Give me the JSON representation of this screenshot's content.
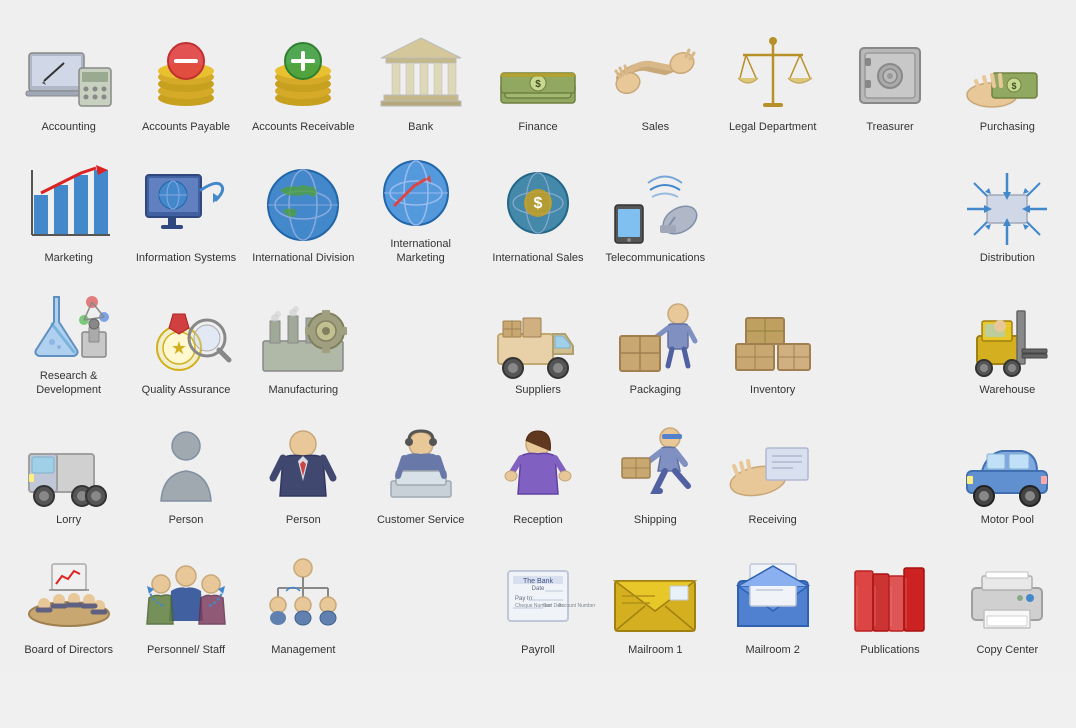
{
  "items": [
    {
      "id": "accounting",
      "label": "Accounting",
      "icon": "accounting"
    },
    {
      "id": "accounts-payable",
      "label": "Accounts Payable",
      "icon": "accounts-payable"
    },
    {
      "id": "accounts-receivable",
      "label": "Accounts Receivable",
      "icon": "accounts-receivable"
    },
    {
      "id": "bank",
      "label": "Bank",
      "icon": "bank"
    },
    {
      "id": "finance",
      "label": "Finance",
      "icon": "finance"
    },
    {
      "id": "sales",
      "label": "Sales",
      "icon": "sales"
    },
    {
      "id": "legal-department",
      "label": "Legal Department",
      "icon": "legal-department"
    },
    {
      "id": "treasurer",
      "label": "Treasurer",
      "icon": "treasurer"
    },
    {
      "id": "purchasing",
      "label": "Purchasing",
      "icon": "purchasing"
    },
    {
      "id": "marketing",
      "label": "Marketing",
      "icon": "marketing"
    },
    {
      "id": "information-systems",
      "label": "Information Systems",
      "icon": "information-systems"
    },
    {
      "id": "international-division",
      "label": "International Division",
      "icon": "international-division"
    },
    {
      "id": "international-marketing",
      "label": "International Marketing",
      "icon": "international-marketing"
    },
    {
      "id": "international-sales",
      "label": "International Sales",
      "icon": "international-sales"
    },
    {
      "id": "telecommunications",
      "label": "Telecommunications",
      "icon": "telecommunications"
    },
    {
      "id": "blank1",
      "label": "",
      "icon": "blank"
    },
    {
      "id": "blank2",
      "label": "",
      "icon": "blank"
    },
    {
      "id": "distribution",
      "label": "Distribution",
      "icon": "distribution"
    },
    {
      "id": "research-development",
      "label": "Research & Development",
      "icon": "research-development"
    },
    {
      "id": "quality-assurance",
      "label": "Quality Assurance",
      "icon": "quality-assurance"
    },
    {
      "id": "manufacturing",
      "label": "Manufacturing",
      "icon": "manufacturing"
    },
    {
      "id": "blank3",
      "label": "",
      "icon": "blank"
    },
    {
      "id": "suppliers",
      "label": "Suppliers",
      "icon": "suppliers"
    },
    {
      "id": "packaging",
      "label": "Packaging",
      "icon": "packaging"
    },
    {
      "id": "inventory",
      "label": "Inventory",
      "icon": "inventory"
    },
    {
      "id": "blank4",
      "label": "",
      "icon": "blank"
    },
    {
      "id": "warehouse",
      "label": "Warehouse",
      "icon": "warehouse"
    },
    {
      "id": "lorry",
      "label": "Lorry",
      "icon": "lorry"
    },
    {
      "id": "person1",
      "label": "Person",
      "icon": "person"
    },
    {
      "id": "person2",
      "label": "Person",
      "icon": "person2"
    },
    {
      "id": "customer-service",
      "label": "Customer Service",
      "icon": "customer-service"
    },
    {
      "id": "reception",
      "label": "Reception",
      "icon": "reception"
    },
    {
      "id": "shipping",
      "label": "Shipping",
      "icon": "shipping"
    },
    {
      "id": "receiving",
      "label": "Receiving",
      "icon": "receiving"
    },
    {
      "id": "blank5",
      "label": "",
      "icon": "blank"
    },
    {
      "id": "motor-pool",
      "label": "Motor Pool",
      "icon": "motor-pool"
    },
    {
      "id": "board-of-directors",
      "label": "Board of Directors",
      "icon": "board-of-directors"
    },
    {
      "id": "personnel-staff",
      "label": "Personnel/ Staff",
      "icon": "personnel-staff"
    },
    {
      "id": "management",
      "label": "Management",
      "icon": "management"
    },
    {
      "id": "blank6",
      "label": "",
      "icon": "blank"
    },
    {
      "id": "payroll",
      "label": "Payroll",
      "icon": "payroll"
    },
    {
      "id": "mailroom1",
      "label": "Mailroom 1",
      "icon": "mailroom1"
    },
    {
      "id": "mailroom2",
      "label": "Mailroom 2",
      "icon": "mailroom2"
    },
    {
      "id": "publications",
      "label": "Publications",
      "icon": "publications"
    },
    {
      "id": "copy-center",
      "label": "Copy Center",
      "icon": "copy-center"
    }
  ]
}
